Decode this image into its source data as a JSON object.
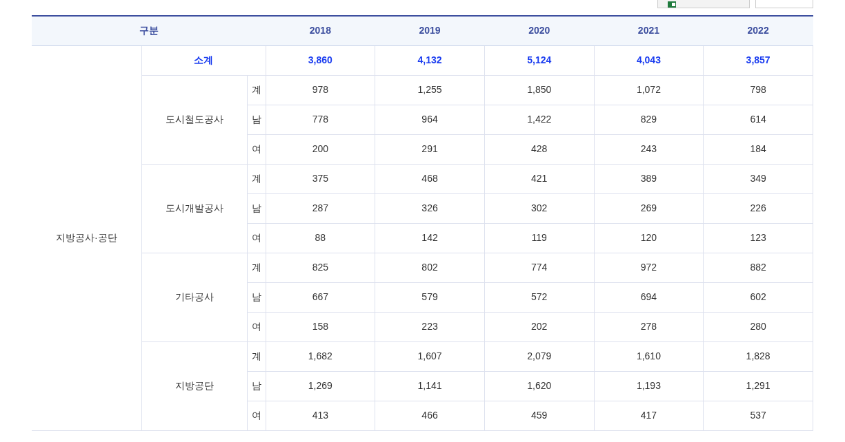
{
  "table": {
    "columns": [
      "구분",
      "2018",
      "2019",
      "2020",
      "2021",
      "2022"
    ],
    "category": "지방공사·공단",
    "subtotal": {
      "label": "소계",
      "values": [
        "3,860",
        "4,132",
        "5,124",
        "4,043",
        "3,857"
      ]
    },
    "groups": [
      {
        "name": "도시철도공사",
        "rows": [
          {
            "label": "계",
            "values": [
              "978",
              "1,255",
              "1,850",
              "1,072",
              "798"
            ]
          },
          {
            "label": "남",
            "values": [
              "778",
              "964",
              "1,422",
              "829",
              "614"
            ]
          },
          {
            "label": "여",
            "values": [
              "200",
              "291",
              "428",
              "243",
              "184"
            ]
          }
        ]
      },
      {
        "name": "도시개발공사",
        "rows": [
          {
            "label": "계",
            "values": [
              "375",
              "468",
              "421",
              "389",
              "349"
            ]
          },
          {
            "label": "남",
            "values": [
              "287",
              "326",
              "302",
              "269",
              "226"
            ]
          },
          {
            "label": "여",
            "values": [
              "88",
              "142",
              "119",
              "120",
              "123"
            ]
          }
        ]
      },
      {
        "name": "기타공사",
        "rows": [
          {
            "label": "계",
            "values": [
              "825",
              "802",
              "774",
              "972",
              "882"
            ]
          },
          {
            "label": "남",
            "values": [
              "667",
              "579",
              "572",
              "694",
              "602"
            ]
          },
          {
            "label": "여",
            "values": [
              "158",
              "223",
              "202",
              "278",
              "280"
            ]
          }
        ]
      },
      {
        "name": "지방공단",
        "rows": [
          {
            "label": "계",
            "values": [
              "1,682",
              "1,607",
              "2,079",
              "1,610",
              "1,828"
            ]
          },
          {
            "label": "남",
            "values": [
              "1,269",
              "1,141",
              "1,620",
              "1,193",
              "1,291"
            ]
          },
          {
            "label": "여",
            "values": [
              "413",
              "466",
              "459",
              "417",
              "537"
            ]
          }
        ]
      }
    ]
  }
}
